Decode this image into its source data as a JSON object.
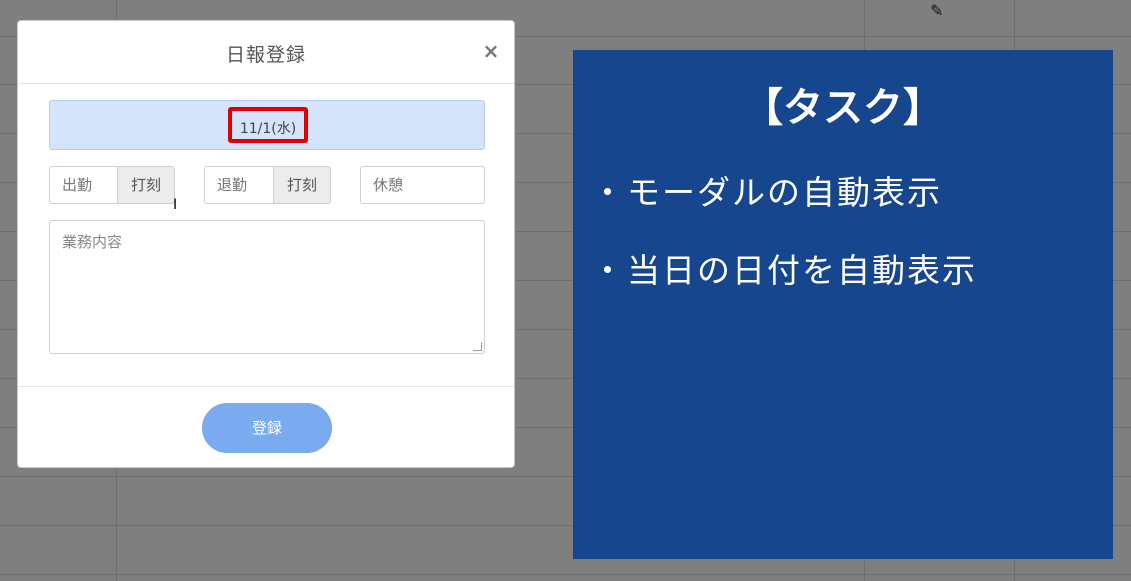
{
  "modal": {
    "title": "日報登録",
    "close_label": "×",
    "date": "11/1(水)",
    "clock_in": {
      "placeholder": "出勤",
      "button": "打刻"
    },
    "clock_out": {
      "placeholder": "退勤",
      "button": "打刻"
    },
    "break": {
      "placeholder": "休憩"
    },
    "work_content": {
      "placeholder": "業務内容"
    },
    "submit_label": "登録"
  },
  "task_panel": {
    "title": "【タスク】",
    "bullet": "・",
    "items": [
      "モーダルの自動表示",
      "当日の日付を自動表示"
    ]
  },
  "icons": {
    "edit": "pencil-icon",
    "cursor": "text-cursor-icon"
  },
  "colors": {
    "task_panel_bg": "#16468e",
    "date_bar_bg": "#d6e4fb",
    "highlight_border": "#e00000",
    "submit_bg": "#7aaaf0"
  }
}
